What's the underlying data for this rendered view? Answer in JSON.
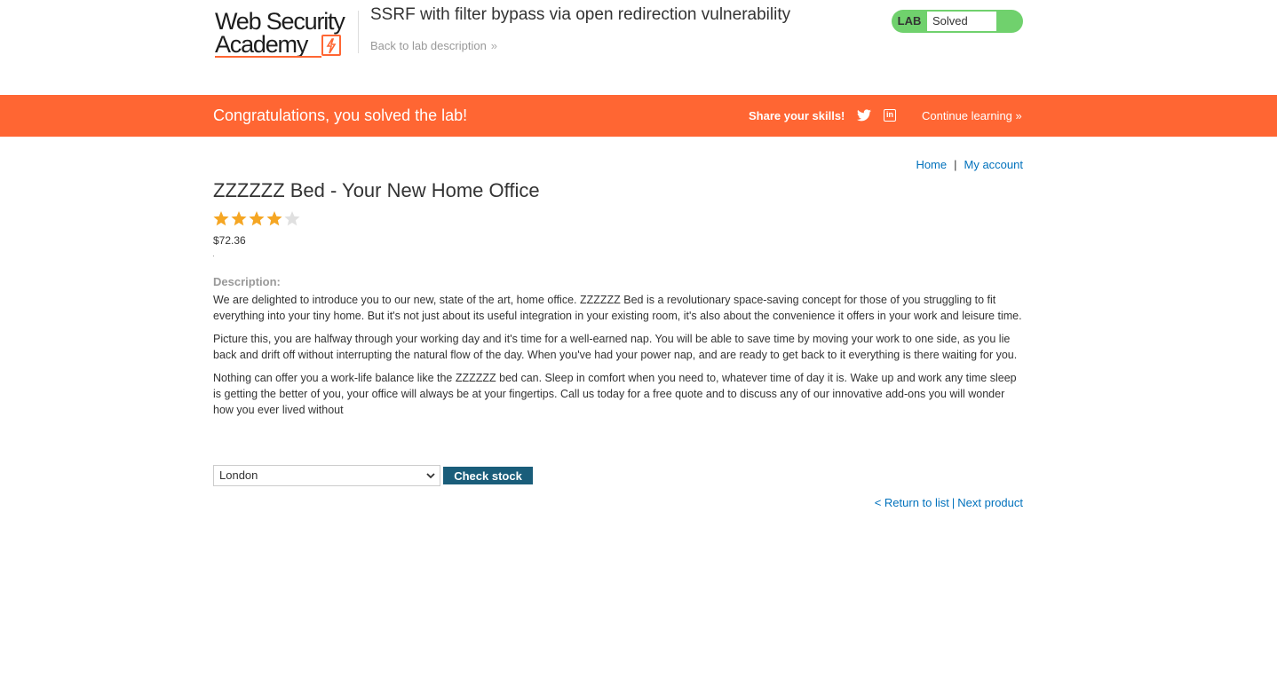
{
  "header": {
    "logo_line1": "Web Security",
    "logo_line2": "Academy",
    "lab_title": "SSRF with filter bypass via open redirection vulnerability",
    "back_link": "Back to lab description",
    "status_label": "LAB",
    "status_value": "Solved",
    "status_color": "#70d16d"
  },
  "banner": {
    "message": "Congratulations, you solved the lab!",
    "share_label": "Share your skills!",
    "icons": [
      "twitter-icon",
      "linkedin-icon"
    ],
    "continue_link": "Continue learning",
    "color": "#ff6633"
  },
  "nav": {
    "home": "Home",
    "separator": "|",
    "my_account": "My account"
  },
  "product": {
    "title": "ZZZZZZ Bed - Your New Home Office",
    "rating": 4,
    "rating_max": 5,
    "price": "$72.36",
    "description_label": "Description:",
    "description": [
      "We are delighted to introduce you to our new, state of the art, home office. ZZZZZZ Bed is a revolutionary space-saving concept for those of you struggling to fit everything into your tiny home. But it's not just about its useful integration in your existing room, it's also about the convenience it offers in your work and leisure time.",
      "Picture this, you are halfway through your working day and it's time for a well-earned nap. You will be able to save time by moving your work to one side, as you lie back and drift off without interrupting the natural flow of the day. When you've had your power nap, and are ready to get back to it everything is there waiting for you.",
      "Nothing can offer you a work-life balance like the ZZZZZZ bed can. Sleep in comfort when you need to, whatever time of day it is. Wake up and work any time sleep is getting the better of you, your office will always be at your fingertips. Call us today for a free quote and to discuss any of our innovative add-ons you will wonder how you ever lived without"
    ]
  },
  "stock": {
    "selected_store": "London",
    "button_label": "Check stock"
  },
  "pager": {
    "return": "< Return to list",
    "separator": "|",
    "next": "Next product"
  }
}
